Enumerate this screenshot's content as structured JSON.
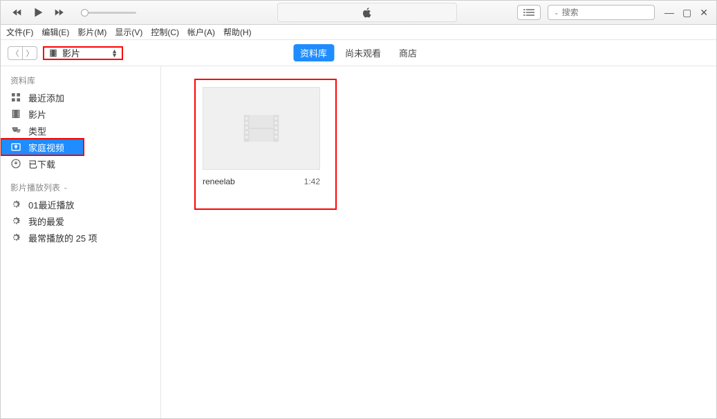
{
  "search": {
    "placeholder": "搜索"
  },
  "menubar": [
    "文件(F)",
    "编辑(E)",
    "影片(M)",
    "显示(V)",
    "控制(C)",
    "帐户(A)",
    "帮助(H)"
  ],
  "mediaDropdown": {
    "label": "影片"
  },
  "tabs": [
    {
      "label": "资料库",
      "active": true
    },
    {
      "label": "尚未观看",
      "active": false
    },
    {
      "label": "商店",
      "active": false
    }
  ],
  "sidebar": {
    "sectionLibrary": "资料库",
    "libraryItems": [
      {
        "label": "最近添加",
        "icon": "grid"
      },
      {
        "label": "影片",
        "icon": "film"
      },
      {
        "label": "类型",
        "icon": "masks"
      },
      {
        "label": "家庭视频",
        "icon": "home",
        "selected": true,
        "highlight": true
      },
      {
        "label": "已下载",
        "icon": "download"
      }
    ],
    "sectionPlaylists": "影片播放列表",
    "playlistItems": [
      {
        "label": "01最近播放",
        "icon": "gear"
      },
      {
        "label": "我的最爱",
        "icon": "gear"
      },
      {
        "label": "最常播放的 25 项",
        "icon": "gear"
      }
    ]
  },
  "video": {
    "title": "reneelab",
    "duration": "1:42"
  }
}
